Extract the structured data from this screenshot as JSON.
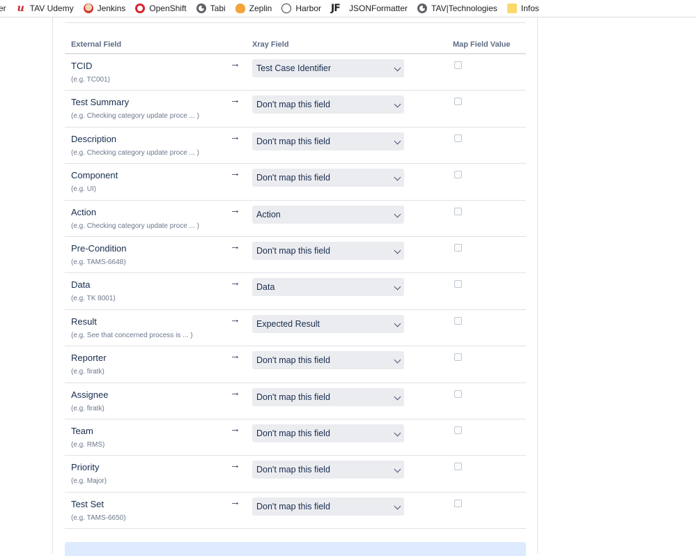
{
  "bookmarks": [
    {
      "label": "er",
      "icon": "none"
    },
    {
      "label": "TAV Udemy",
      "icon": "udemy-icon"
    },
    {
      "label": "Jenkins",
      "icon": "jenkins-icon"
    },
    {
      "label": "OpenShift",
      "icon": "openshift-icon"
    },
    {
      "label": "Tabi",
      "icon": "globe-icon"
    },
    {
      "label": "Zeplin",
      "icon": "zeplin-icon"
    },
    {
      "label": "Harbor",
      "icon": "harbor-icon"
    },
    {
      "label": "JSONFormatter",
      "icon": "jsonformatter-icon",
      "glyph": "JF"
    },
    {
      "label": "TAV|Technologies",
      "icon": "globe-icon"
    },
    {
      "label": "Infos",
      "icon": "folder-icon"
    }
  ],
  "table": {
    "headers": {
      "external_field": "External Field",
      "xray_field": "Xray Field",
      "map_field_value": "Map Field Value"
    },
    "rows": [
      {
        "name": "TCID",
        "example": "(e.g. TC001)",
        "arrow": "→",
        "selected": "Test Case Identifier",
        "checked": false
      },
      {
        "name": "Test Summary",
        "example": "(e.g. Checking category update proce ... )",
        "arrow": "→",
        "selected": "Don't map this field",
        "checked": false
      },
      {
        "name": "Description",
        "example": "(e.g. Checking category update proce ... )",
        "arrow": "→",
        "selected": "Don't map this field",
        "checked": false
      },
      {
        "name": "Component",
        "example": "(e.g. UI)",
        "arrow": "→",
        "selected": "Don't map this field",
        "checked": false
      },
      {
        "name": "Action",
        "example": "(e.g. Checking category update proce ... )",
        "arrow": "→",
        "selected": "Action",
        "checked": false
      },
      {
        "name": "Pre-Condition",
        "example": "(e.g. TAMS-6648)",
        "arrow": "→",
        "selected": "Don't map this field",
        "checked": false
      },
      {
        "name": "Data",
        "example": "(e.g. TK 8001)",
        "arrow": "→",
        "selected": "Data",
        "checked": false
      },
      {
        "name": "Result",
        "example": "(e.g. See that concerned process is ... )",
        "arrow": "→",
        "selected": "Expected Result",
        "checked": false
      },
      {
        "name": "Reporter",
        "example": "(e.g. firatk)",
        "arrow": "→",
        "selected": "Don't map this field",
        "checked": false
      },
      {
        "name": "Assignee",
        "example": "(e.g. firatk)",
        "arrow": "→",
        "selected": "Don't map this field",
        "checked": false
      },
      {
        "name": "Team",
        "example": "(e.g. RMS)",
        "arrow": "→",
        "selected": "Don't map this field",
        "checked": false
      },
      {
        "name": "Priority",
        "example": "(e.g. Major)",
        "arrow": "→",
        "selected": "Don't map this field",
        "checked": false
      },
      {
        "name": "Test Set",
        "example": "(e.g. TAMS-6650)",
        "arrow": "→",
        "selected": "Don't map this field",
        "checked": false
      }
    ]
  },
  "colors": {
    "select_bg": "#ebecf0",
    "divider": "#dfe1e6",
    "info_bar": "#deebff"
  }
}
